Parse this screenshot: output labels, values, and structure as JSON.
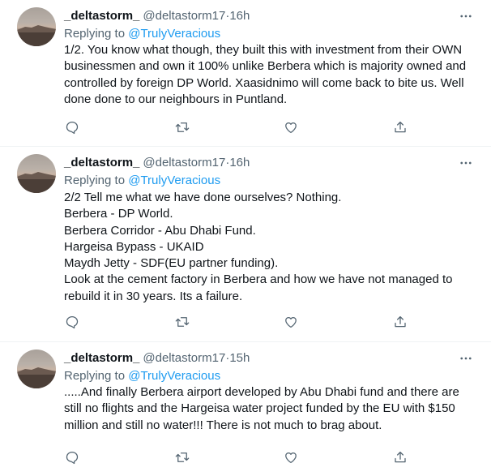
{
  "tweets": [
    {
      "name": "_deltastorm_",
      "handle": "@deltastorm17",
      "separator": "·",
      "time": "16h",
      "replying_prefix": "Replying to ",
      "replying_to": "@TrulyVeracious",
      "lines": [
        "1/2. You know what though, they built this with investment from their OWN",
        "businessmen and own it 100% unlike Berbera which is majority owned and",
        "controlled by foreign DP World. Xaasidnimo will come back to bite us.  Well",
        "done done to our neighbours in Puntland."
      ]
    },
    {
      "name": "_deltastorm_",
      "handle": "@deltastorm17",
      "separator": "·",
      "time": "16h",
      "replying_prefix": "Replying to ",
      "replying_to": "@TrulyVeracious",
      "lines": [
        "2/2 Tell me what we have done ourselves? Nothing.",
        "Berbera - DP World.",
        "Berbera Corridor - Abu Dhabi Fund.",
        "Hargeisa Bypass - UKAID",
        "Maydh Jetty - SDF(EU partner funding).",
        "Look at the cement factory in Berbera and how we have not managed to",
        "rebuild it in 30 years. Its a failure."
      ]
    },
    {
      "name": "_deltastorm_",
      "handle": "@deltastorm17",
      "separator": "·",
      "time": "15h",
      "replying_prefix": "Replying to ",
      "replying_to": "@TrulyVeracious",
      "lines": [
        ".....And finally Berbera airport developed by Abu Dhabi fund and there are",
        "still no flights and the Hargeisa water project funded by the EU with $150",
        "million and still no water!!! There is not much to brag about."
      ]
    }
  ],
  "icons": {
    "more": "more-horizontal-icon",
    "reply": "comment-icon",
    "retweet": "retweet-icon",
    "like": "heart-icon",
    "share": "share-icon"
  },
  "colors": {
    "text": "#0f1419",
    "secondary": "#536471",
    "link": "#1d9bf0",
    "divider": "#eff3f4"
  }
}
